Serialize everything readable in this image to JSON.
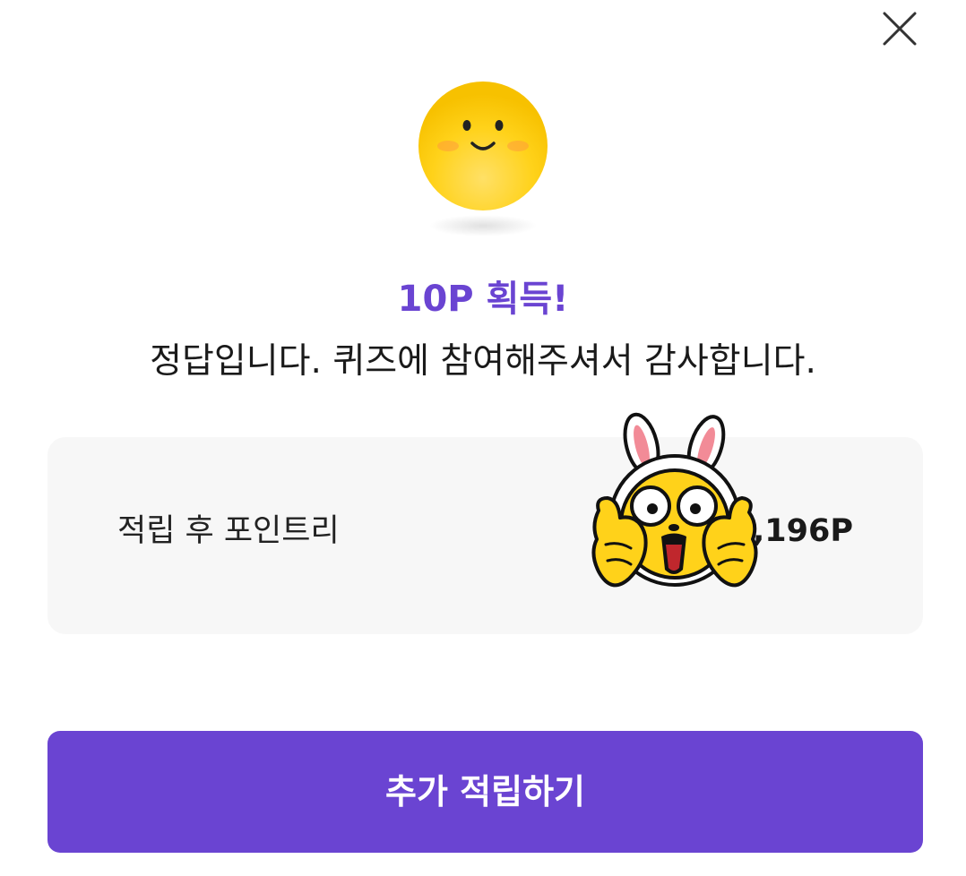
{
  "dialog": {
    "close_icon": "close-icon",
    "headline": "10P 획득!",
    "message": "정답입니다. 퀴즈에 참여해주셔서 감사합니다.",
    "smiley_icon": "smiley-face-icon",
    "accent_color": "#6a44d2"
  },
  "points_card": {
    "label": "적립 후 포인트리",
    "value": "0,196P",
    "sticker_icon": "bunny-character-sticker"
  },
  "cta": {
    "label": "추가 적립하기"
  }
}
